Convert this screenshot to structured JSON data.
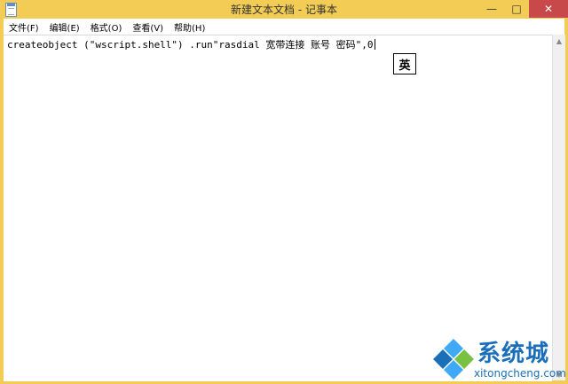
{
  "window": {
    "title": "新建文本文档 - 记事本",
    "controls": {
      "minimize": "—",
      "maximize": "□",
      "close": "✕"
    }
  },
  "menu": [
    {
      "label": "文件(F)"
    },
    {
      "label": "编辑(E)"
    },
    {
      "label": "格式(O)"
    },
    {
      "label": "查看(V)"
    },
    {
      "label": "帮助(H)"
    }
  ],
  "editor": {
    "content": "createobject (\"wscript.shell\") .run\"rasdial 宽带连接 账号 密码\",0"
  },
  "ime": {
    "mode": "英"
  },
  "scrollbar": {
    "up_icon": "▲",
    "down_icon": "▼"
  },
  "watermark": {
    "brand": "系统城",
    "domain": "xitongcheng.com",
    "colors": {
      "blue": "#1b6fb9",
      "green": "#7ac143",
      "light_blue": "#3fa9f5"
    }
  },
  "colors": {
    "frame": "#f3cc55",
    "close_button": "#c7494a"
  }
}
